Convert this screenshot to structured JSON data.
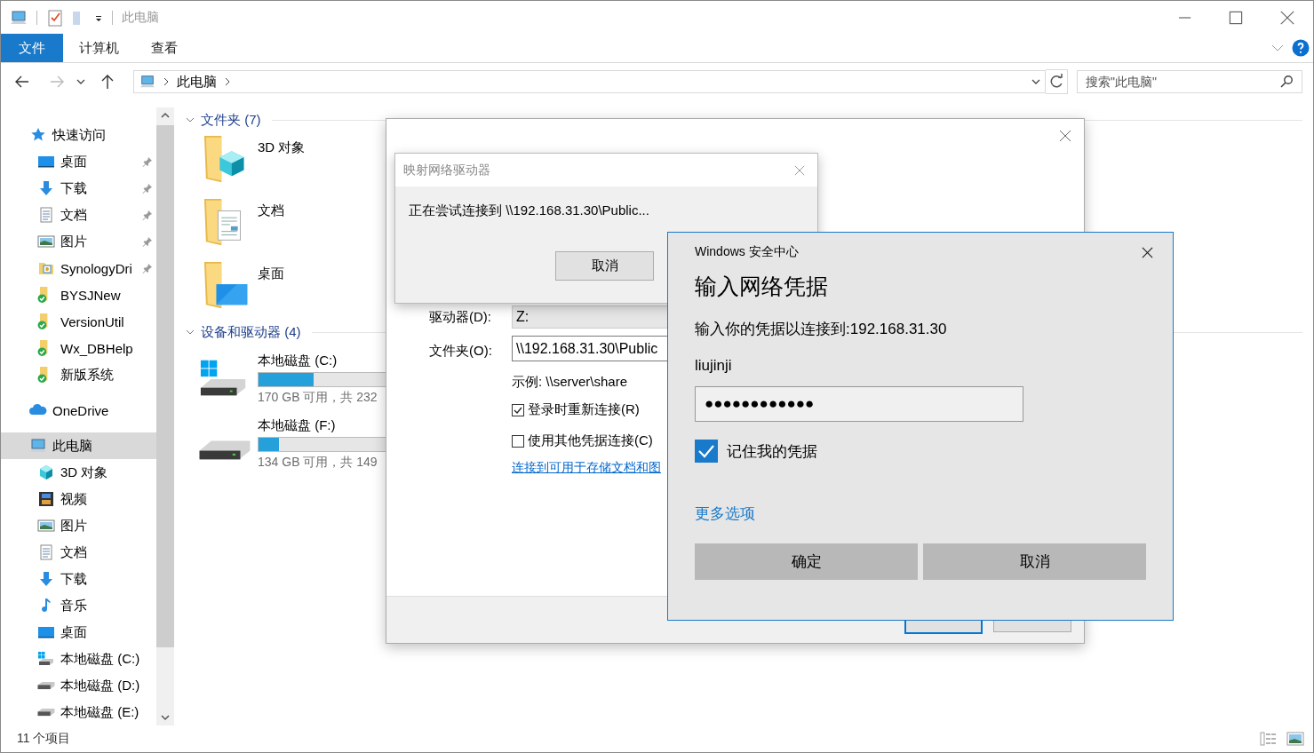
{
  "window": {
    "title": "此电脑"
  },
  "ribbon": {
    "tabs": [
      {
        "label": "文件",
        "selected": true
      },
      {
        "label": "计算机",
        "selected": false
      },
      {
        "label": "查看",
        "selected": false
      }
    ]
  },
  "address_bar": {
    "path": [
      "此电脑"
    ]
  },
  "search": {
    "placeholder": "搜索\"此电脑\""
  },
  "sidebar": {
    "items": [
      {
        "label": "快速访问",
        "kind": "star",
        "selected": false,
        "children": [
          {
            "label": "桌面",
            "kind": "desktop",
            "pinned": true,
            "selected": false
          },
          {
            "label": "下载",
            "kind": "download",
            "pinned": true,
            "selected": false
          },
          {
            "label": "文档",
            "kind": "document",
            "pinned": true,
            "selected": false
          },
          {
            "label": "图片",
            "kind": "picture",
            "pinned": true,
            "selected": false
          },
          {
            "label": "SynologyDri",
            "kind": "app-folder",
            "pinned": true,
            "selected": false
          },
          {
            "label": "BYSJNew",
            "kind": "synced-folder",
            "pinned": false,
            "selected": false
          },
          {
            "label": "VersionUtil",
            "kind": "synced-folder",
            "pinned": false,
            "selected": false
          },
          {
            "label": "Wx_DBHelp",
            "kind": "synced-folder",
            "pinned": false,
            "selected": false
          },
          {
            "label": "新版系统",
            "kind": "synced-folder",
            "pinned": false,
            "selected": false
          }
        ]
      },
      {
        "label": "OneDrive",
        "kind": "cloud",
        "selected": false
      },
      {
        "label": "此电脑",
        "kind": "computer",
        "selected": true,
        "children": [
          {
            "label": "3D 对象",
            "kind": "cube",
            "pinned": false,
            "selected": false
          },
          {
            "label": "视频",
            "kind": "video",
            "pinned": false,
            "selected": false
          },
          {
            "label": "图片",
            "kind": "picture",
            "pinned": false,
            "selected": false
          },
          {
            "label": "文档",
            "kind": "document",
            "pinned": false,
            "selected": false
          },
          {
            "label": "下载",
            "kind": "download",
            "pinned": false,
            "selected": false
          },
          {
            "label": "音乐",
            "kind": "music",
            "pinned": false,
            "selected": false
          },
          {
            "label": "桌面",
            "kind": "desktop",
            "pinned": false,
            "selected": false
          },
          {
            "label": "本地磁盘 (C:)",
            "kind": "system-drive",
            "pinned": false,
            "selected": false
          },
          {
            "label": "本地磁盘 (D:)",
            "kind": "drive",
            "pinned": false,
            "selected": false
          },
          {
            "label": "本地磁盘 (E:)",
            "kind": "drive",
            "pinned": false,
            "selected": false
          }
        ]
      }
    ]
  },
  "content": {
    "groups": [
      {
        "title": "文件夹 (7)",
        "expanded": true,
        "items": [
          {
            "name": "3D 对象",
            "kind": "cube-folder"
          },
          {
            "name": "文档",
            "kind": "document-folder"
          },
          {
            "name": "桌面",
            "kind": "desktop-folder"
          }
        ]
      },
      {
        "title": "设备和驱动器 (4)",
        "expanded": true,
        "items": [
          {
            "name": "本地磁盘 (C:)",
            "kind": "system-drive",
            "level": 0.27,
            "space": "170 GB 可用，共 232"
          },
          {
            "name": "本地磁盘 (F:)",
            "kind": "drive",
            "level": 0.1,
            "space": "134 GB 可用，共 149"
          }
        ]
      }
    ]
  },
  "status_bar": {
    "item_count": "11 个项目"
  },
  "map_drive_dialog": {
    "drive_label": "驱动器(D):",
    "drive_value": "Z:",
    "folder_label": "文件夹(O):",
    "folder_value": "\\\\192.168.31.30\\Public",
    "example": "示例: \\\\server\\share",
    "options": [
      {
        "label": "登录时重新连接(R)",
        "checked": true
      },
      {
        "label": "使用其他凭据连接(C)",
        "checked": false
      }
    ],
    "link": "连接到可用于存储文档和图"
  },
  "progress_dialog": {
    "title": "映射网络驱动器",
    "message": "正在尝试连接到 \\\\192.168.31.30\\Public...",
    "button": "取消"
  },
  "security_dialog": {
    "caption": "Windows 安全中心",
    "heading": "输入网络凭据",
    "prompt": "输入你的凭据以连接到:192.168.31.30",
    "username": "liujinji",
    "password": "●●●●●●●●●●●●",
    "remember": {
      "label": "记住我的凭据",
      "checked": true
    },
    "more_link": "更多选项",
    "buttons": [
      "确定",
      "取消"
    ]
  }
}
